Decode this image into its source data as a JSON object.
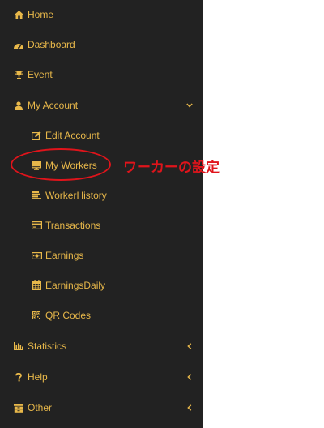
{
  "sidebar": {
    "items": [
      {
        "label": "Home",
        "icon": "home-icon"
      },
      {
        "label": "Dashboard",
        "icon": "dashboard-icon"
      },
      {
        "label": "Event",
        "icon": "trophy-icon"
      },
      {
        "label": "My Account",
        "icon": "user-icon",
        "expanded": true
      },
      {
        "label": "Edit Account",
        "icon": "edit-icon"
      },
      {
        "label": "My Workers",
        "icon": "monitor-icon"
      },
      {
        "label": "WorkerHistory",
        "icon": "list-icon"
      },
      {
        "label": "Transactions",
        "icon": "credit-card-icon"
      },
      {
        "label": "Earnings",
        "icon": "money-icon"
      },
      {
        "label": "EarningsDaily",
        "icon": "calendar-icon"
      },
      {
        "label": "QR Codes",
        "icon": "qrcode-icon"
      },
      {
        "label": "Statistics",
        "icon": "bar-chart-icon"
      },
      {
        "label": "Help",
        "icon": "question-icon"
      },
      {
        "label": "Other",
        "icon": "archive-icon"
      }
    ]
  },
  "annotation": {
    "text": "ワーカーの設定"
  },
  "colors": {
    "sidebar_bg": "#222222",
    "menu_text": "#e8b84a",
    "annotation": "#e0141b",
    "page_bg": "#ffffff"
  }
}
